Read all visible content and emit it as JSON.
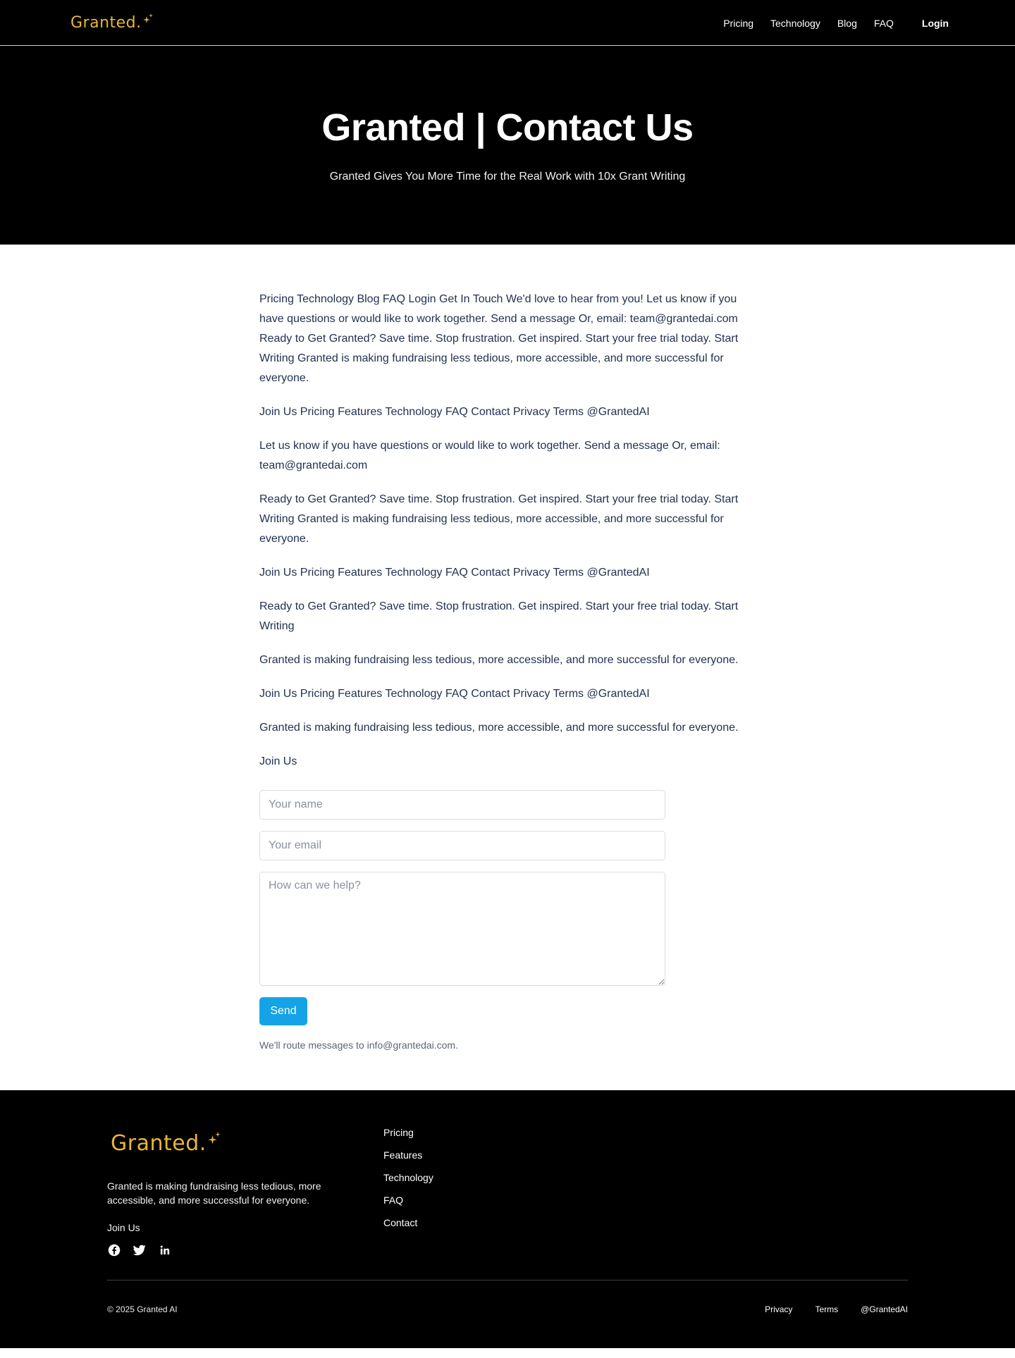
{
  "header": {
    "logo_text": "Granted",
    "logo_dot": ".",
    "nav": [
      "Pricing",
      "Technology",
      "Blog",
      "FAQ"
    ],
    "login_label": "Login"
  },
  "hero": {
    "title": "Granted | Contact Us",
    "subtitle": "Granted Gives You More Time for the Real Work with 10x Grant Writing"
  },
  "content": {
    "paragraphs": [
      "Pricing Technology Blog FAQ Login Get In Touch We'd love to hear from you! Let us know if you have questions or would like to work together. Send a message Or, email: team@grantedai.com Ready to Get Granted? Save time. Stop frustration. Get inspired. Start your free trial today. Start Writing Granted is making fundraising less tedious, more accessible, and more successful for everyone.",
      "Join Us Pricing Features Technology FAQ Contact Privacy Terms @GrantedAI",
      "Let us know if you have questions or would like to work together. Send a message Or, email: team@grantedai.com",
      "Ready to Get Granted? Save time. Stop frustration. Get inspired. Start your free trial today. Start Writing Granted is making fundraising less tedious, more accessible, and more successful for everyone.",
      "Join Us Pricing Features Technology FAQ Contact Privacy Terms @GrantedAI",
      "Ready to Get Granted? Save time. Stop frustration. Get inspired. Start your free trial today. Start Writing",
      "Granted is making fundraising less tedious, more accessible, and more successful for everyone.",
      "Join Us Pricing Features Technology FAQ Contact Privacy Terms @GrantedAI",
      "Granted is making fundraising less tedious, more accessible, and more successful for everyone.",
      "Join Us"
    ]
  },
  "form": {
    "name_placeholder": "Your name",
    "email_placeholder": "Your email",
    "message_placeholder": "How can we help?",
    "send_label": "Send",
    "note": "We'll route messages to info@grantedai.com."
  },
  "footer": {
    "logo_text": "Granted",
    "logo_dot": ".",
    "tagline": "Granted is making fundraising less tedious, more accessible, and more successful for everyone.",
    "join_us": "Join Us",
    "social_icons": [
      "facebook-icon",
      "twitter-icon",
      "linkedin-icon"
    ],
    "links": [
      "Pricing",
      "Features",
      "Technology",
      "FAQ",
      "Contact"
    ],
    "copyright": "© 2025 Granted AI",
    "legal": [
      "Privacy",
      "Terms",
      "@GrantedAI"
    ]
  },
  "colors": {
    "background_dark": "#000000",
    "brand_gold": "#e8b53a",
    "accent_blue": "#14a3e6",
    "body_text": "#233150"
  }
}
